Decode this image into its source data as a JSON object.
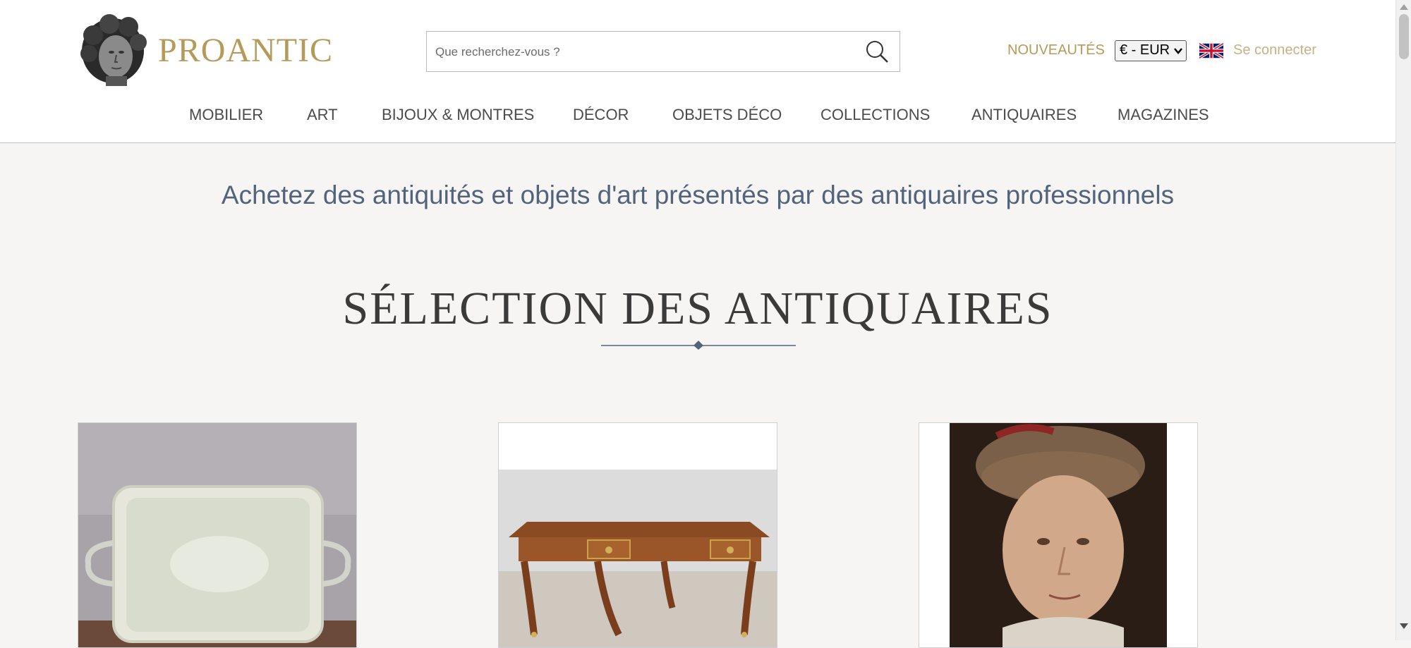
{
  "header": {
    "brand": "PROANTIC",
    "search_placeholder": "Que recherchez-vous ?",
    "new_link": "NOUVEAUTÉS",
    "currency": "€ - EUR",
    "language_icon": "uk-flag-icon",
    "login": "Se connecter"
  },
  "nav": {
    "items": [
      {
        "label": "MOBILIER"
      },
      {
        "label": "ART"
      },
      {
        "label": "BIJOUX & MONTRES"
      },
      {
        "label": "DÉCOR"
      },
      {
        "label": "OBJETS DÉCO"
      },
      {
        "label": "COLLECTIONS"
      },
      {
        "label": "ANTIQUAIRES"
      },
      {
        "label": "MAGAZINES"
      }
    ]
  },
  "main": {
    "tagline": "Achetez des antiquités et objets d'art présentés par des antiquaires professionnels",
    "section_title": "SÉLECTION DES ANTIQUAIRES",
    "products": [
      {
        "image": "silver-tray-image"
      },
      {
        "image": "louis-xv-desk-image"
      },
      {
        "image": "portrait-painting-image"
      }
    ]
  },
  "colors": {
    "brand_gold": "#b69a5a",
    "tagline_blue": "#52647c",
    "background": "#f6f5f3"
  }
}
